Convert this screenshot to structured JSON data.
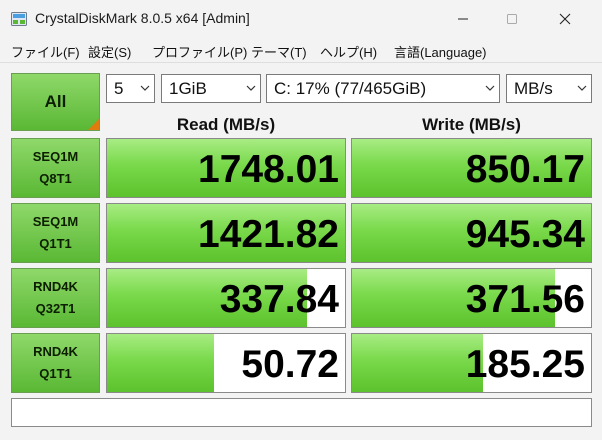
{
  "window": {
    "title": "CrystalDiskMark 8.0.5 x64 [Admin]"
  },
  "menu": [
    "ファイル(F)",
    "設定(S)",
    "プロファイル(P)",
    "テーマ(T)",
    "ヘルプ(H)",
    "言語(Language)"
  ],
  "controls": {
    "all_label": "All",
    "count": "5",
    "size": "1GiB",
    "drive": "C: 17% (77/465GiB)",
    "unit": "MB/s"
  },
  "headers": {
    "read": "Read (MB/s)",
    "write": "Write (MB/s)"
  },
  "rows": [
    {
      "line1": "SEQ1M",
      "line2": "Q8T1",
      "read": "1748.01",
      "write": "850.17",
      "read_fill_pct": 100,
      "write_fill_pct": 100
    },
    {
      "line1": "SEQ1M",
      "line2": "Q1T1",
      "read": "1421.82",
      "write": "945.34",
      "read_fill_pct": 100,
      "write_fill_pct": 100
    },
    {
      "line1": "RND4K",
      "line2": "Q32T1",
      "read": "337.84",
      "write": "371.56",
      "read_fill_pct": 84,
      "write_fill_pct": 85
    },
    {
      "line1": "RND4K",
      "line2": "Q1T1",
      "read": "50.72",
      "write": "185.25",
      "read_fill_pct": 45,
      "write_fill_pct": 55
    }
  ],
  "comment": "",
  "colors": {
    "accent_green": "#5ab834",
    "corner_orange": "#e07b0e"
  },
  "icons": [
    "app-icon",
    "minimize-icon",
    "maximize-icon",
    "close-icon",
    "chevron-down-icon"
  ]
}
